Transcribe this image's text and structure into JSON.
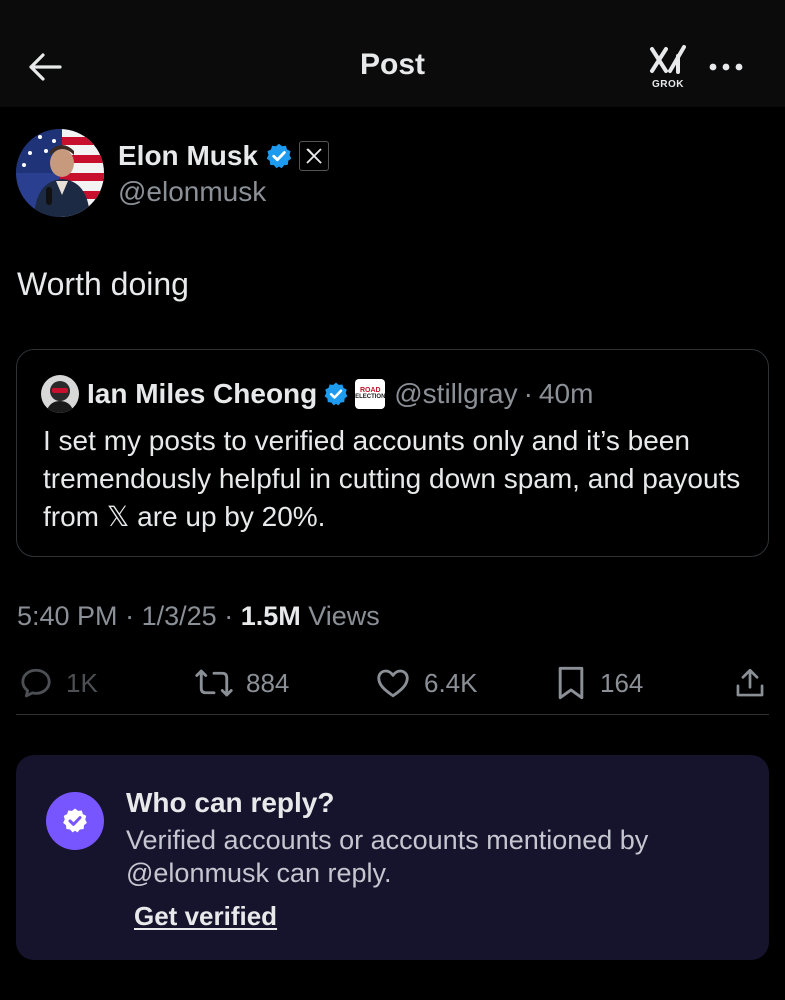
{
  "header": {
    "title": "Post",
    "grok_label": "GROK"
  },
  "author": {
    "name": "Elon Musk",
    "handle": "@elonmusk",
    "affiliation_glyph": "𝕏"
  },
  "tweet": {
    "text": "Worth doing"
  },
  "quote": {
    "name": "Ian Miles Cheong",
    "handle": "@stillgray",
    "separator": "·",
    "time": "40m",
    "affil_line1": "ROAD",
    "affil_line2": "ELECTION",
    "text": "I set my posts to verified accounts only and it’s been tremendously helpful in cutting down spam, and payouts from 𝕏 are up by 20%."
  },
  "meta": {
    "time": "5:40 PM",
    "sep1": "·",
    "date": "1/3/25",
    "sep2": "·",
    "views_count": "1.5M",
    "views_label": "Views"
  },
  "actions": {
    "replies": "1K",
    "reposts": "884",
    "likes": "6.4K",
    "bookmarks": "164"
  },
  "reply_settings": {
    "title": "Who can reply?",
    "description": "Verified accounts or accounts mentioned by @elonmusk can reply.",
    "link": "Get verified"
  },
  "colors": {
    "background": "#000000",
    "verified_blue": "#1d9bf0",
    "muted_text": "#8b9097",
    "card_bg": "#16142c",
    "accent_purple": "#7856ff"
  }
}
